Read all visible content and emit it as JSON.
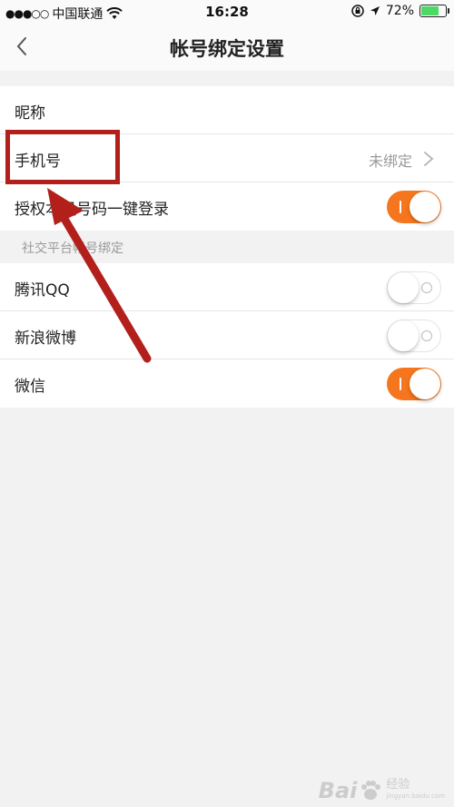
{
  "status_bar": {
    "signal_dots": "●●●○○",
    "carrier": "中国联通",
    "time": "16:28",
    "battery_percent": "72%",
    "battery_level": 0.72,
    "battery_color": "#4cd964"
  },
  "nav": {
    "title": "帐号绑定设置",
    "back_icon": "chevron-left-icon"
  },
  "account_section": {
    "nickname_label": "昵称",
    "phone_label": "手机号",
    "phone_value": "未绑定",
    "one_click_label": "授权本机号码一键登录",
    "one_click_on": true
  },
  "social_section": {
    "header": "社交平台帐号绑定",
    "items": [
      {
        "label": "腾讯QQ",
        "on": false
      },
      {
        "label": "新浪微博",
        "on": false
      },
      {
        "label": "微信",
        "on": true
      }
    ]
  },
  "colors": {
    "accent": "#f5761e",
    "annotation": "#b3201c",
    "background": "#f2f2f2"
  },
  "watermark": {
    "brand": "Bai",
    "sub_top": "经验",
    "sub_bottom": "jingyan.baidu.com"
  }
}
